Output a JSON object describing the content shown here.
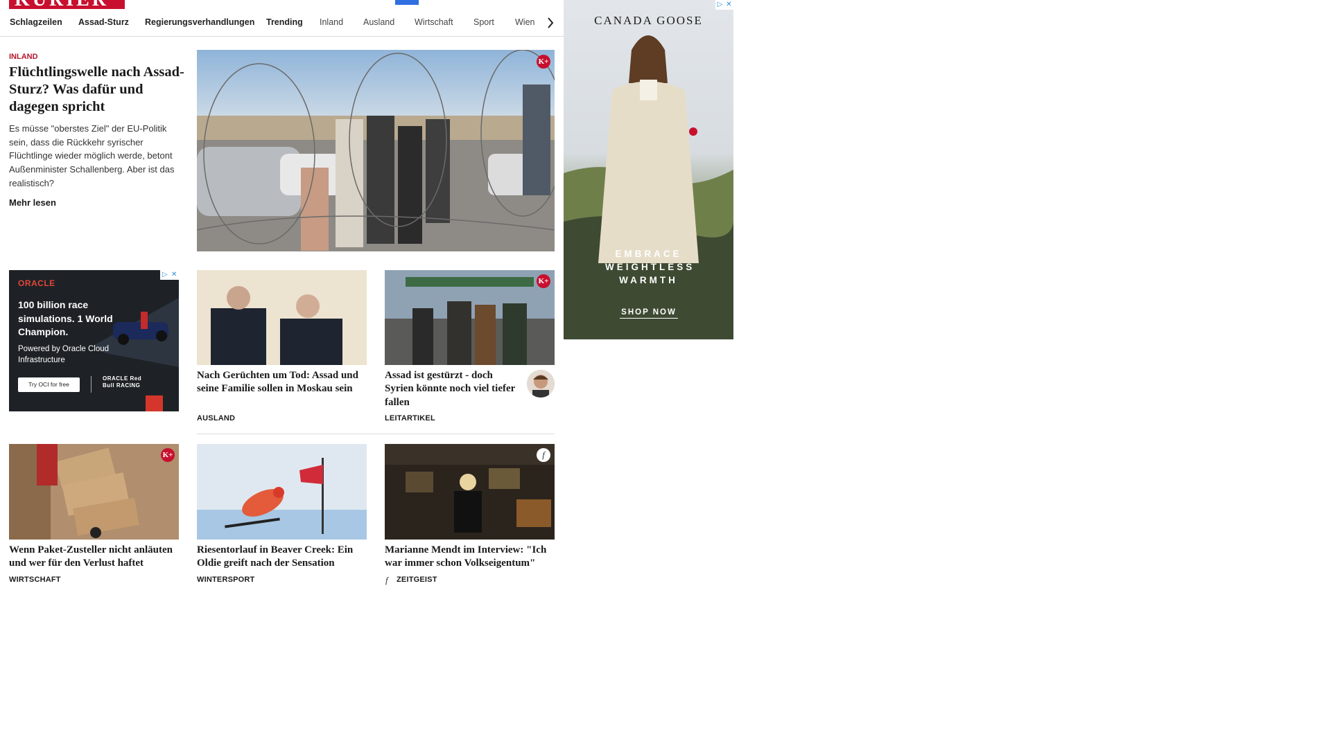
{
  "header": {
    "logo_text": "KURIER"
  },
  "nav": {
    "items": [
      {
        "label": "Schlagzeilen"
      },
      {
        "label": "Assad-Sturz"
      },
      {
        "label": "Regierungsverhandlungen"
      },
      {
        "label": "Trending"
      },
      {
        "label": "Inland"
      },
      {
        "label": "Ausland"
      },
      {
        "label": "Wirtschaft"
      },
      {
        "label": "Sport"
      },
      {
        "label": "Wien"
      }
    ],
    "next_icon": "chevron-right-icon"
  },
  "lead": {
    "kicker": "INLAND",
    "title": "Flüchtlingswelle nach Assad-Sturz? Was dafür und dagegen spricht",
    "teaser": "Es müsse \"oberstes Ziel\" der EU-Politik sein, dass die Rückkehr syrischer Flüchtlinge wieder möglich werde, betont Außenminister Schallenberg. Aber ist das realistisch?",
    "more_label": "Mehr lesen",
    "badge": "K+"
  },
  "cards": [
    {
      "title": "Nach Gerüchten um Tod: Assad und seine Familie sollen in Moskau sein",
      "category": "AUSLAND"
    },
    {
      "title": "Assad ist gestürzt - doch Syrien könnte noch viel tie­fer fallen",
      "category": "LEITARTIKEL",
      "badge": "K+"
    },
    {
      "title": "Wenn Paket-Zusteller nicht anläu­ten und wer für den Verlust haftet",
      "category": "WIRTSCHAFT",
      "badge": "K+"
    },
    {
      "title": "Riesentorlauf in Beaver Creek: Ein Oldie greift nach der Sensation",
      "category": "WINTERSPORT"
    },
    {
      "title": "Marianne Mendt im Interview: \"Ich war immer schon Volkseigentum\"",
      "category": "ZEITGEIST",
      "badge": "f"
    }
  ],
  "ads": {
    "oracle": {
      "logo": "ORACLE",
      "headline": "100 billion race simulations. 1 World Champion.",
      "sub": "Powered by Oracle Cloud Infrastructure",
      "button": "Try OCI for free",
      "brand": "ORACLE Red Bull RACING"
    },
    "canada_goose": {
      "brand": "CANADA GOOSE",
      "tagline": "EMBRACE WEIGHTLESS WARMTH",
      "cta": "SHOP NOW"
    },
    "adchoices": {
      "play": "▷",
      "close": "✕"
    }
  },
  "colors": {
    "brand_red": "#c8102e",
    "kicker_red": "#b5162b",
    "divider": "#d9d9d9"
  }
}
